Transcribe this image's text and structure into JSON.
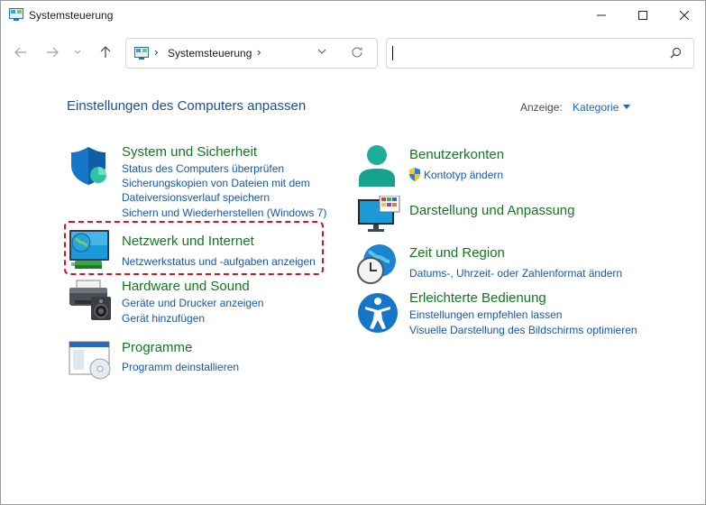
{
  "window": {
    "title": "Systemsteuerung"
  },
  "address_bar": {
    "path": "Systemsteuerung",
    "separator": "›"
  },
  "search": {
    "value": "",
    "placeholder": ""
  },
  "header": {
    "title": "Einstellungen des Computers anpassen",
    "view_label": "Anzeige:",
    "view_value": "Kategorie"
  },
  "categories_left": [
    {
      "title": "System und Sicherheit",
      "icon": "shield-icon",
      "links": [
        "Status des Computers überprüfen",
        "Sicherungskopien von Dateien mit dem",
        "Dateiversionsverlauf speichern",
        "Sichern und Wiederherstellen (Windows 7)"
      ]
    },
    {
      "title": "Netzwerk und Internet",
      "icon": "network-globe-icon",
      "links": [
        "Netzwerkstatus und -aufgaben anzeigen"
      ]
    },
    {
      "title": "Hardware und Sound",
      "icon": "printer-speaker-icon",
      "links": [
        "Geräte und Drucker anzeigen",
        "Gerät hinzufügen"
      ]
    },
    {
      "title": "Programme",
      "icon": "programs-disc-icon",
      "links": [
        "Programm deinstallieren"
      ]
    }
  ],
  "categories_right": [
    {
      "title": "Benutzerkonten",
      "icon": "user-accounts-icon",
      "links": [
        "Kontotyp ändern"
      ]
    },
    {
      "title": "Darstellung und Anpassung",
      "icon": "monitor-palette-icon",
      "links": []
    },
    {
      "title": "Zeit und Region",
      "icon": "clock-globe-icon",
      "links": [
        "Datums-, Uhrzeit- oder Zahlenformat ändern"
      ]
    },
    {
      "title": "Erleichterte Bedienung",
      "icon": "accessibility-icon",
      "links": [
        "Einstellungen empfehlen lassen",
        "Visuelle Darstellung des Bildschirms optimieren"
      ]
    }
  ],
  "colors": {
    "category_title": "#0f7a1d",
    "link": "#1656b8",
    "page_title": "#1e4e9a",
    "highlight": "#e0111a"
  }
}
